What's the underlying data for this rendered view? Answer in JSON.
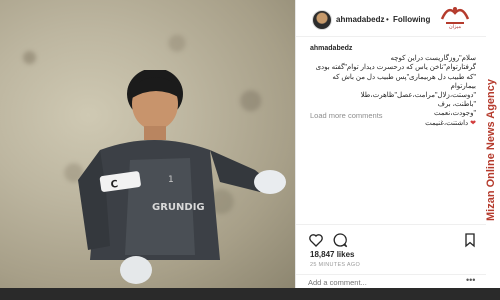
{
  "post": {
    "username": "ahmadabedz",
    "separator": "•",
    "follow_status": "Following",
    "caption_user": "ahmadabedz",
    "caption_lines": [
      "سلام\"روزگاریست دراین کوچه",
      "گرفتارتوام\"ناخن یاس که درحسرت دیدار توام\"گفته بودی",
      "\"که طبیب دل هربیماری\"پس طبیب دل من باش که بیمارتوام",
      "\"دوستت،زلال\"مرامت،عصل\"ظاهرت،طلا",
      "\"باطنت، برف",
      "\"وجودت،نعمت",
      "داشتنت،غنیمت"
    ],
    "load_more": "Load more comments",
    "likes": "18,847 likes",
    "time": "25 MINUTES AGO",
    "comment_placeholder": "Add a comment...",
    "more_options": "•••"
  },
  "photo": {
    "jersey_text": "GRUNDIG",
    "armband_text": "C"
  },
  "watermark": {
    "agency": "Mizan Online News Agency",
    "logo_caption": "میزان"
  },
  "colors": {
    "accent": "#b53b2d",
    "text": "#262626",
    "muted": "#8e8e8e"
  }
}
